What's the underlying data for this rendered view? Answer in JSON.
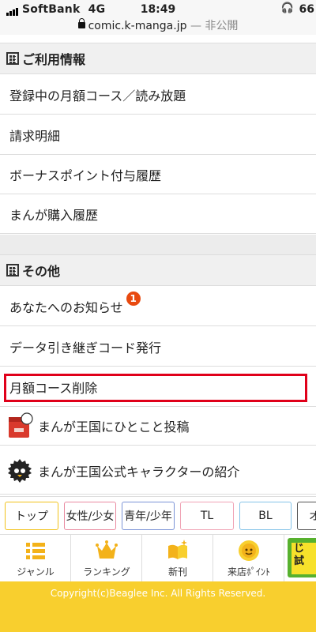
{
  "status": {
    "carrier": "SoftBank",
    "network": "4G",
    "time": "18:49",
    "battery": "66"
  },
  "browser": {
    "url": "comic.k-manga.jp",
    "privacy": "— 非公開"
  },
  "usage": {
    "header": "ご利用情報",
    "items": [
      "登録中の月額コース／読み放題",
      "請求明細",
      "ボーナスポイント付与履歴",
      "まんが購入履歴"
    ]
  },
  "other": {
    "header": "その他",
    "items": [
      {
        "label": "あなたへのお知らせ",
        "badge": "1"
      },
      {
        "label": "データ引き継ぎコード発行"
      },
      {
        "label": "月額コース削除"
      },
      {
        "label": "まんが王国にひとこと投稿"
      },
      {
        "label": "まんが王国公式キャラクターの紹介"
      }
    ]
  },
  "tags": [
    {
      "label": "トップ",
      "color": "#f2c21a"
    },
    {
      "label": "女性/少女",
      "color": "#e98aa0"
    },
    {
      "label": "青年/少年",
      "color": "#7b93d6"
    },
    {
      "label": "TL",
      "color": "#f0a3b5"
    },
    {
      "label": "BL",
      "color": "#84c3e8"
    },
    {
      "label": "オ",
      "color": "#555555"
    }
  ],
  "tabs": [
    {
      "label": "ジャンル",
      "icon": "list-icon"
    },
    {
      "label": "ランキング",
      "icon": "crown-icon"
    },
    {
      "label": "新刊",
      "icon": "new-book-icon"
    },
    {
      "label": "来店ﾎﾟｲﾝﾄ",
      "icon": "sun-face-icon"
    }
  ],
  "promo": {
    "text": "じ\n試"
  },
  "footer": {
    "copyright": "Copyright(c)Beaglee Inc. All Rights Reserved."
  },
  "colors": {
    "accent": "#f8cf2e",
    "highlight": "#e0001a",
    "badge": "#e8490f"
  }
}
